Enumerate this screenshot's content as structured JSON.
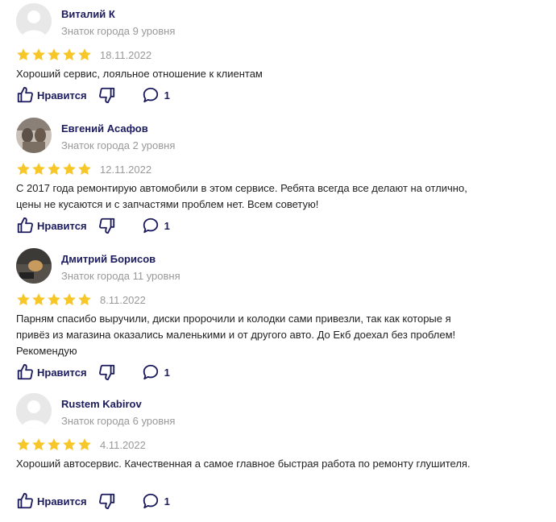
{
  "labels": {
    "like": "Нравится"
  },
  "colors": {
    "star": "#f7c72a",
    "accent": "#1b1b5e",
    "muted": "#999999"
  },
  "icons": [
    "avatar-placeholder-icon",
    "star-icon",
    "thumbs-up-icon",
    "thumbs-down-icon",
    "comment-icon"
  ],
  "reviews": [
    {
      "author": "Виталий К",
      "level": "Знаток города 9 уровня",
      "rating": 5,
      "date": "18.11.2022",
      "text": "Хороший сервис, лояльное отношение к клиентам",
      "comments": "1",
      "avatar": "placeholder"
    },
    {
      "author": "Евгений Асафов",
      "level": "Знаток города 2 уровня",
      "rating": 5,
      "date": "12.11.2022",
      "text": "С 2017 года ремонтирую автомобили в этом сервисе. Ребята всегда все делают на отлично, цены не кусаются и с запчастями проблем нет. Всем советую!",
      "comments": "1",
      "avatar": "photo"
    },
    {
      "author": "Дмитрий Борисов",
      "level": "Знаток города 11 уровня",
      "rating": 5,
      "date": "8.11.2022",
      "text": "Парням спасибо выручили, диски пророчили и колодки сами привезли, так как которые я привёз из магазина оказались маленькими и от другого авто. До Екб доехал без проблем! Рекомендую",
      "comments": "1",
      "avatar": "photo"
    },
    {
      "author": "Rustem Kabirov",
      "level": "Знаток города 6 уровня",
      "rating": 5,
      "date": "4.11.2022",
      "text": "Хороший автосервис. Качественная а самое главное быстрая работа по ремонту глушителя.",
      "comments": "1",
      "avatar": "placeholder"
    }
  ]
}
